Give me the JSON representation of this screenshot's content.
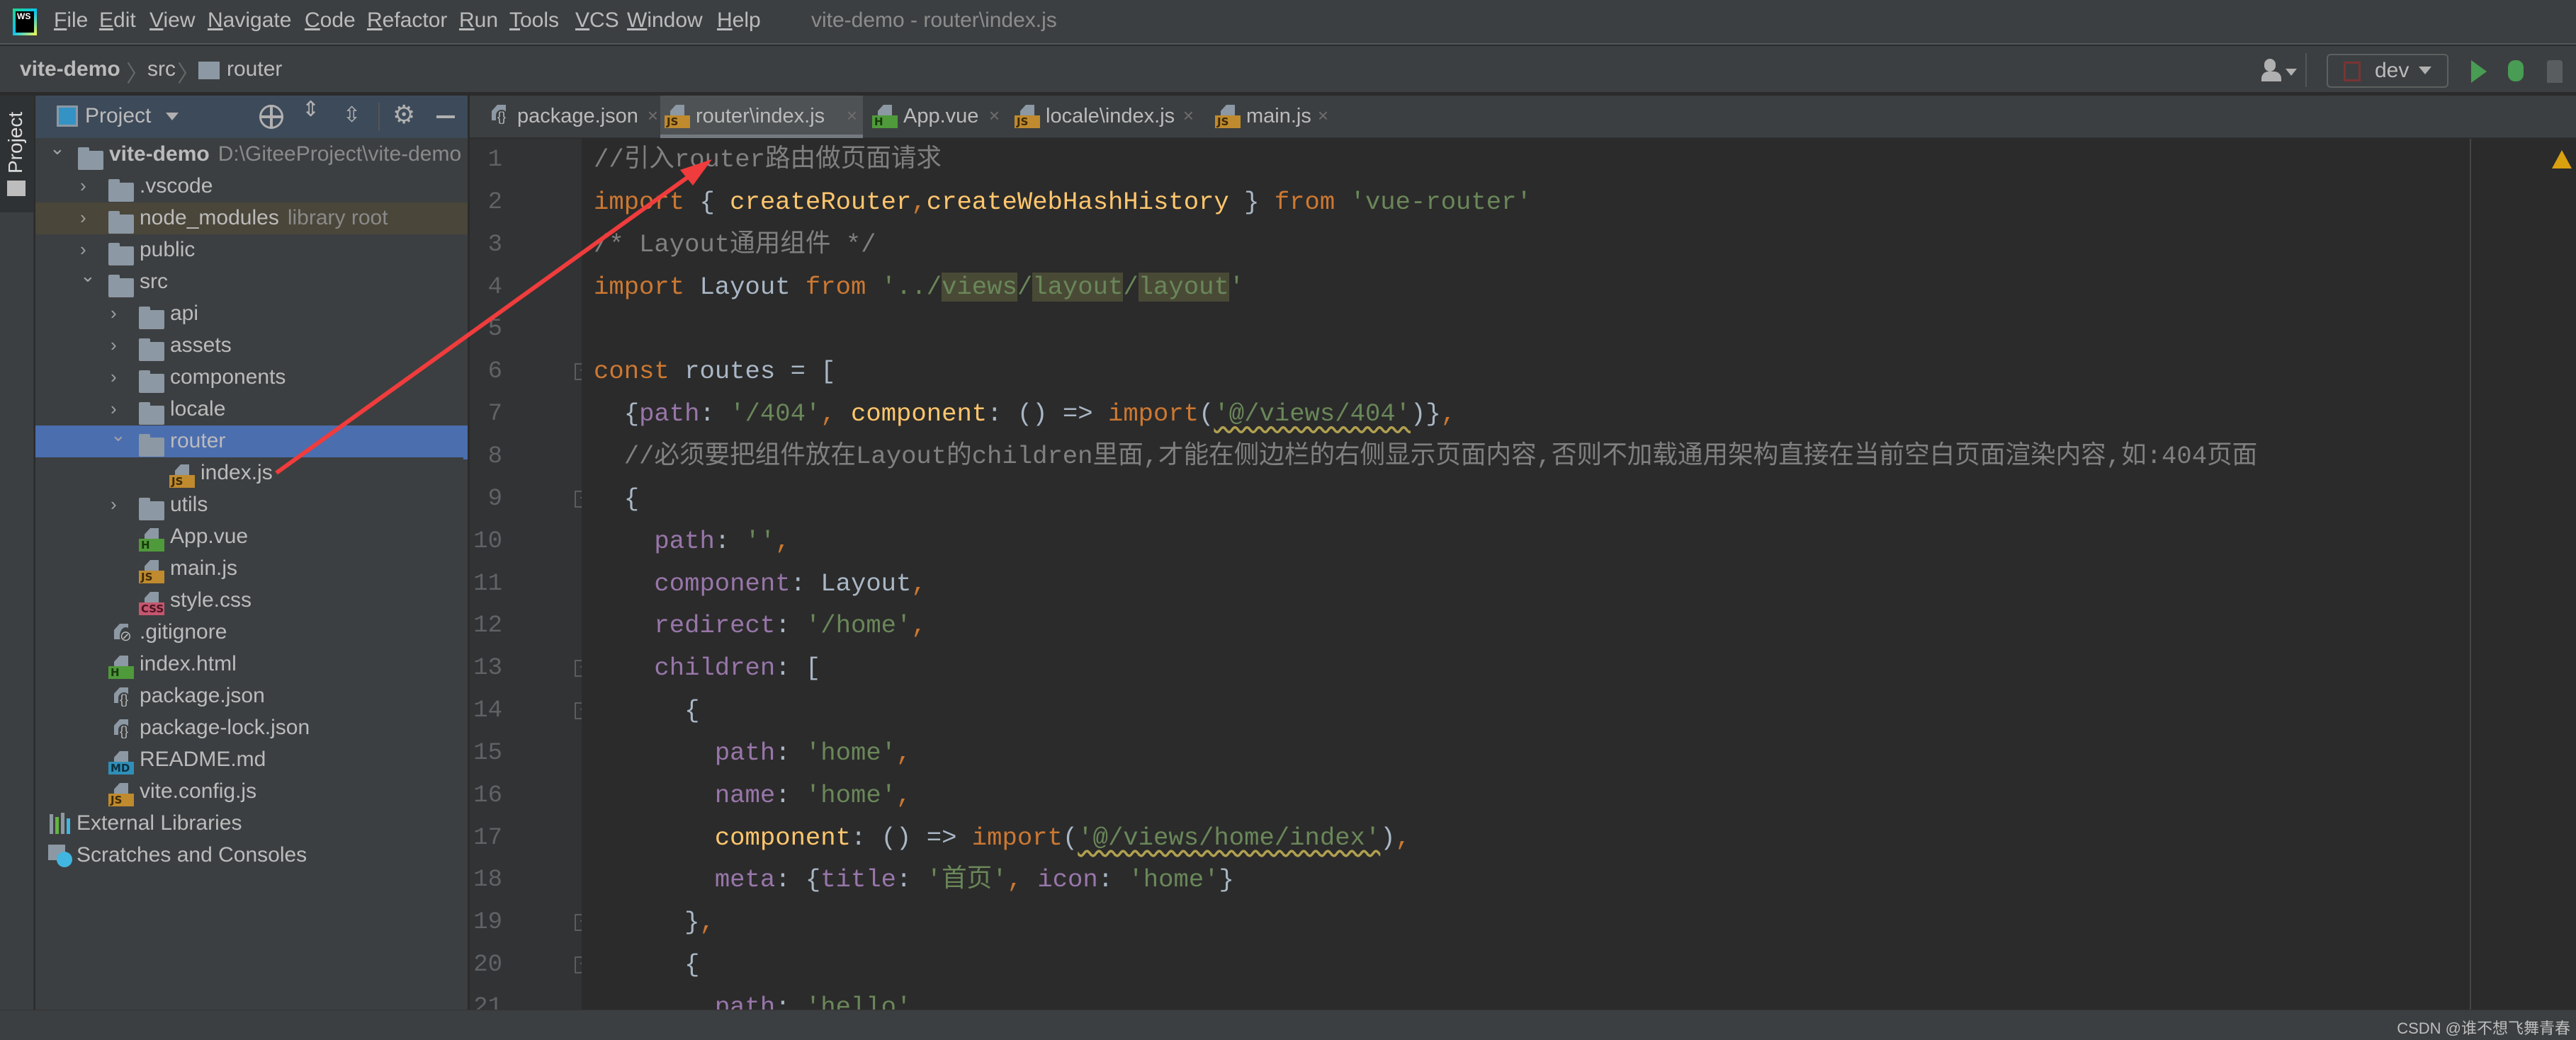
{
  "menu": {
    "items": [
      "File",
      "Edit",
      "View",
      "Navigate",
      "Code",
      "Refactor",
      "Run",
      "Tools",
      "VCS",
      "Window",
      "Help"
    ],
    "window_title": "vite-demo - router\\index.js"
  },
  "breadcrumb": {
    "project": "vite-demo",
    "folder1": "src",
    "folder2": "router"
  },
  "toolbar": {
    "run_config": "dev"
  },
  "sidebar": {
    "stripe_label": "Project",
    "panel_title": "Project"
  },
  "tree": [
    {
      "label": "vite-demo",
      "hint": "D:\\GiteeProject\\vite-demo",
      "level": 0,
      "kind": "folder",
      "expanded": true,
      "bold": true
    },
    {
      "label": ".vscode",
      "level": 1,
      "kind": "folder",
      "expanded": false
    },
    {
      "label": "node_modules",
      "hint": "library root",
      "level": 1,
      "kind": "folder",
      "expanded": false,
      "style": "lib"
    },
    {
      "label": "public",
      "level": 1,
      "kind": "folder",
      "expanded": false
    },
    {
      "label": "src",
      "level": 1,
      "kind": "folder",
      "expanded": true
    },
    {
      "label": "api",
      "level": 2,
      "kind": "folder",
      "expanded": false
    },
    {
      "label": "assets",
      "level": 2,
      "kind": "folder",
      "expanded": false
    },
    {
      "label": "components",
      "level": 2,
      "kind": "folder",
      "expanded": false
    },
    {
      "label": "locale",
      "level": 2,
      "kind": "folder",
      "expanded": false
    },
    {
      "label": "router",
      "level": 2,
      "kind": "folder",
      "expanded": true,
      "style": "sel"
    },
    {
      "label": "index.js",
      "level": 3,
      "kind": "js"
    },
    {
      "label": "utils",
      "level": 2,
      "kind": "folder",
      "expanded": false
    },
    {
      "label": "App.vue",
      "level": 2,
      "kind": "vue"
    },
    {
      "label": "main.js",
      "level": 2,
      "kind": "js"
    },
    {
      "label": "style.css",
      "level": 2,
      "kind": "css"
    },
    {
      "label": ".gitignore",
      "level": 1,
      "kind": "ignore"
    },
    {
      "label": "index.html",
      "level": 1,
      "kind": "html"
    },
    {
      "label": "package.json",
      "level": 1,
      "kind": "json"
    },
    {
      "label": "package-lock.json",
      "level": 1,
      "kind": "json"
    },
    {
      "label": "README.md",
      "level": 1,
      "kind": "md"
    },
    {
      "label": "vite.config.js",
      "level": 1,
      "kind": "js"
    },
    {
      "label": "External Libraries",
      "level": 0,
      "kind": "libs",
      "noChevron": true
    },
    {
      "label": "Scratches and Consoles",
      "level": 0,
      "kind": "scratch",
      "noChevron": true
    }
  ],
  "tabs": [
    {
      "label": "package.json",
      "kind": "json",
      "active": false
    },
    {
      "label": "router\\index.js",
      "kind": "js",
      "active": true
    },
    {
      "label": "App.vue",
      "kind": "vue",
      "active": false
    },
    {
      "label": "locale\\index.js",
      "kind": "js",
      "active": false
    },
    {
      "label": "main.js",
      "kind": "js",
      "active": false
    }
  ],
  "badges": {
    "js": {
      "text": "JS",
      "bg": "#c08a2e",
      "fg": "#3b2a08"
    },
    "vue": {
      "text": "H",
      "bg": "#4f9a3a",
      "fg": "#173a0c"
    },
    "html": {
      "text": "H",
      "bg": "#4f9a3a",
      "fg": "#173a0c"
    },
    "css": {
      "text": "CSS",
      "bg": "#c4566f",
      "fg": "#4a1420"
    },
    "md": {
      "text": "MD",
      "bg": "#2f8fb8",
      "fg": "#0d2f40"
    }
  },
  "code": [
    {
      "n": "1",
      "tokens": [
        [
          "cmt",
          "//引入router路由做页面请求"
        ]
      ]
    },
    {
      "n": "2",
      "tokens": [
        [
          "kw",
          "import"
        ],
        [
          "plain",
          " { "
        ],
        [
          "fn",
          "createRouter"
        ],
        [
          "kw",
          ","
        ],
        [
          "fn",
          "createWebHashHistory"
        ],
        [
          "plain",
          " } "
        ],
        [
          "kw",
          "from"
        ],
        [
          "plain",
          " "
        ],
        [
          "str",
          "'vue-router'"
        ]
      ]
    },
    {
      "n": "3",
      "tokens": [
        [
          "cmt",
          "/* Layout通用组件 */"
        ]
      ]
    },
    {
      "n": "4",
      "tokens": [
        [
          "kw",
          "import"
        ],
        [
          "plain",
          " Layout "
        ],
        [
          "kw",
          "from"
        ],
        [
          "plain",
          " "
        ],
        [
          "str",
          "'../"
        ],
        [
          "hl",
          "views"
        ],
        [
          "str",
          "/"
        ],
        [
          "hl",
          "layout"
        ],
        [
          "str",
          "/"
        ],
        [
          "hl",
          "layout"
        ],
        [
          "str",
          "'"
        ]
      ]
    },
    {
      "n": "5",
      "tokens": []
    },
    {
      "n": "6",
      "fold": "open",
      "tokens": [
        [
          "kw",
          "const"
        ],
        [
          "plain",
          " routes = ["
        ]
      ]
    },
    {
      "n": "7",
      "tokens": [
        [
          "plain",
          "  {"
        ],
        [
          "prop",
          "path"
        ],
        [
          "plain",
          ": "
        ],
        [
          "str",
          "'/404'"
        ],
        [
          "kw",
          ","
        ],
        [
          "fn",
          " component"
        ],
        [
          "plain",
          ": () => "
        ],
        [
          "kw",
          "import"
        ],
        [
          "plain",
          "("
        ],
        [
          "warn",
          "'@/views/404'"
        ],
        [
          "plain",
          ")}"
        ],
        [
          "kw",
          ","
        ]
      ]
    },
    {
      "n": "8",
      "tokens": [
        [
          "cmt",
          "  //必须要把组件放在Layout的children里面,才能在侧边栏的右侧显示页面内容,否则不加载通用架构直接在当前空白页面渲染内容,如:404页面"
        ]
      ]
    },
    {
      "n": "9",
      "fold": "open",
      "tokens": [
        [
          "plain",
          "  {"
        ]
      ]
    },
    {
      "n": "10",
      "tokens": [
        [
          "plain",
          "    "
        ],
        [
          "prop",
          "path"
        ],
        [
          "plain",
          ": "
        ],
        [
          "str",
          "''"
        ],
        [
          "kw",
          ","
        ]
      ]
    },
    {
      "n": "11",
      "tokens": [
        [
          "plain",
          "    "
        ],
        [
          "prop",
          "component"
        ],
        [
          "plain",
          ": Layout"
        ],
        [
          "kw",
          ","
        ]
      ]
    },
    {
      "n": "12",
      "tokens": [
        [
          "plain",
          "    "
        ],
        [
          "prop",
          "redirect"
        ],
        [
          "plain",
          ": "
        ],
        [
          "str",
          "'/home'"
        ],
        [
          "kw",
          ","
        ]
      ]
    },
    {
      "n": "13",
      "fold": "open",
      "tokens": [
        [
          "plain",
          "    "
        ],
        [
          "prop",
          "children"
        ],
        [
          "plain",
          ": ["
        ]
      ]
    },
    {
      "n": "14",
      "fold": "open",
      "tokens": [
        [
          "plain",
          "      {"
        ]
      ]
    },
    {
      "n": "15",
      "tokens": [
        [
          "plain",
          "        "
        ],
        [
          "prop",
          "path"
        ],
        [
          "plain",
          ": "
        ],
        [
          "str",
          "'home'"
        ],
        [
          "kw",
          ","
        ]
      ]
    },
    {
      "n": "16",
      "tokens": [
        [
          "plain",
          "        "
        ],
        [
          "prop",
          "name"
        ],
        [
          "plain",
          ": "
        ],
        [
          "str",
          "'home'"
        ],
        [
          "kw",
          ","
        ]
      ]
    },
    {
      "n": "17",
      "tokens": [
        [
          "plain",
          "        "
        ],
        [
          "fn",
          "component"
        ],
        [
          "plain",
          ": () => "
        ],
        [
          "kw",
          "import"
        ],
        [
          "plain",
          "("
        ],
        [
          "warn",
          "'@/views/home/index'"
        ],
        [
          "plain",
          ")"
        ],
        [
          "kw",
          ","
        ]
      ]
    },
    {
      "n": "18",
      "tokens": [
        [
          "plain",
          "        "
        ],
        [
          "prop",
          "meta"
        ],
        [
          "plain",
          ": {"
        ],
        [
          "prop",
          "title"
        ],
        [
          "plain",
          ": "
        ],
        [
          "str",
          "'首页'"
        ],
        [
          "kw",
          ","
        ],
        [
          "plain",
          " "
        ],
        [
          "prop",
          "icon"
        ],
        [
          "plain",
          ": "
        ],
        [
          "str",
          "'home'"
        ],
        [
          "plain",
          "}"
        ]
      ]
    },
    {
      "n": "19",
      "fold": "close",
      "tokens": [
        [
          "plain",
          "      }"
        ],
        [
          "kw",
          ","
        ]
      ]
    },
    {
      "n": "20",
      "fold": "open",
      "tokens": [
        [
          "plain",
          "      {"
        ]
      ]
    },
    {
      "n": "21",
      "tokens": [
        [
          "plain",
          "        "
        ],
        [
          "prop",
          "path"
        ],
        [
          "plain",
          ": "
        ],
        [
          "str",
          "'hello'"
        ]
      ]
    }
  ],
  "status": {
    "watermark": "CSDN @谁不想飞舞青春"
  },
  "colors": {
    "annotation_arrow": "#f03c3c",
    "selection": "#4b6eaf",
    "run": "#499c54",
    "warning": "#d9a00f"
  }
}
